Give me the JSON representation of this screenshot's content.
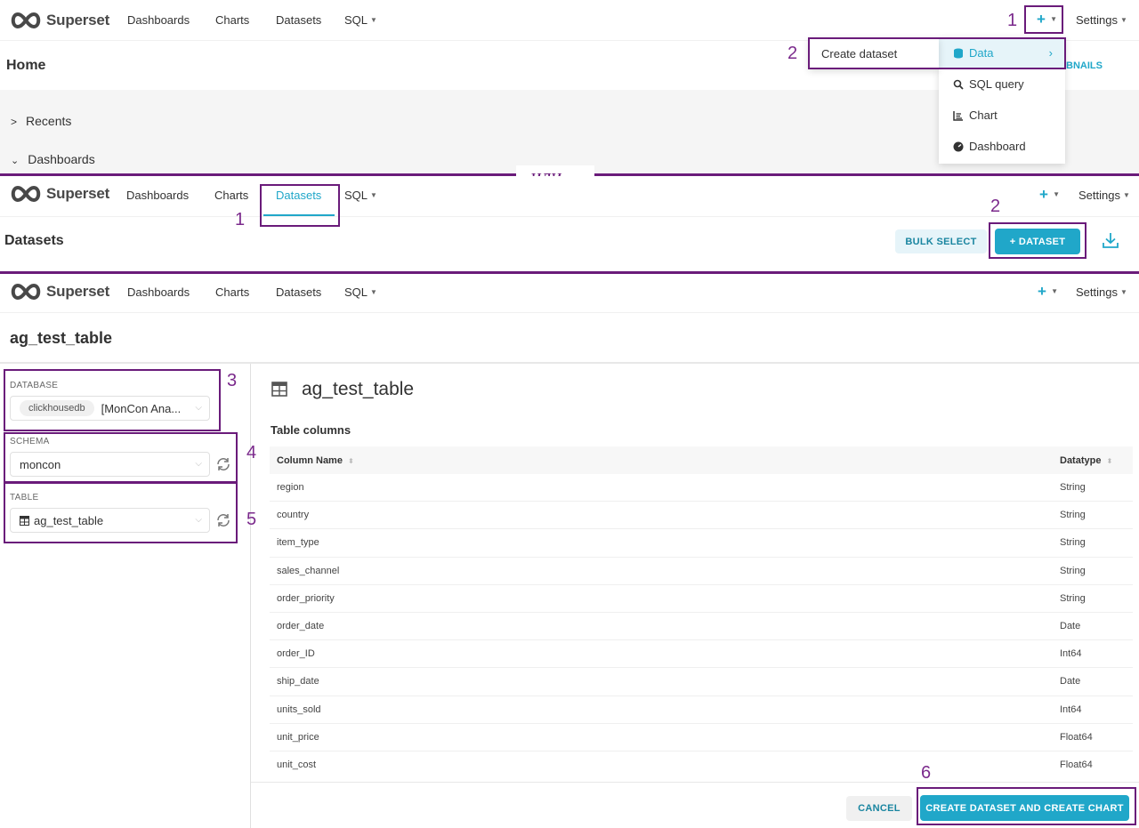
{
  "brand": {
    "name": "Superset"
  },
  "nav": {
    "items": [
      "Dashboards",
      "Charts",
      "Datasets",
      "SQL"
    ],
    "plus": "+",
    "settings": "Settings"
  },
  "section1": {
    "title": "Home",
    "partial_link": "BNAILS",
    "recents": "Recents",
    "dashboards": "Dashboards",
    "submenu_label": "Create dataset",
    "menu": [
      {
        "label": "Data",
        "icon": "database-icon"
      },
      {
        "label": "SQL query",
        "icon": "search-icon"
      },
      {
        "label": "Chart",
        "icon": "chart-icon"
      },
      {
        "label": "Dashboard",
        "icon": "dashboard-icon"
      }
    ],
    "annotations": [
      "1",
      "2"
    ]
  },
  "separator": {
    "text": "или"
  },
  "section2": {
    "title": "Datasets",
    "bulk_select": "BULK SELECT",
    "add_dataset": "+ DATASET",
    "annotations": [
      "1",
      "2"
    ]
  },
  "section3": {
    "title": "ag_test_table",
    "database": {
      "label": "DATABASE",
      "tag": "clickhousedb",
      "value": "[MonCon Ana..."
    },
    "schema": {
      "label": "SCHEMA",
      "value": "moncon"
    },
    "table": {
      "label": "TABLE",
      "value": "ag_test_table"
    },
    "panel_title": "ag_test_table",
    "columns_heading": "Table columns",
    "headers": [
      "Column Name",
      "Datatype"
    ],
    "rows": [
      [
        "region",
        "String"
      ],
      [
        "country",
        "String"
      ],
      [
        "item_type",
        "String"
      ],
      [
        "sales_channel",
        "String"
      ],
      [
        "order_priority",
        "String"
      ],
      [
        "order_date",
        "Date"
      ],
      [
        "order_ID",
        "Int64"
      ],
      [
        "ship_date",
        "Date"
      ],
      [
        "units_sold",
        "Int64"
      ],
      [
        "unit_price",
        "Float64"
      ],
      [
        "unit_cost",
        "Float64"
      ]
    ],
    "cancel": "CANCEL",
    "create": "CREATE DATASET AND CREATE CHART",
    "annotations": [
      "3",
      "4",
      "5",
      "6"
    ]
  },
  "colors": {
    "accent": "#20a7c9",
    "annotation": "#6a1b7a"
  }
}
